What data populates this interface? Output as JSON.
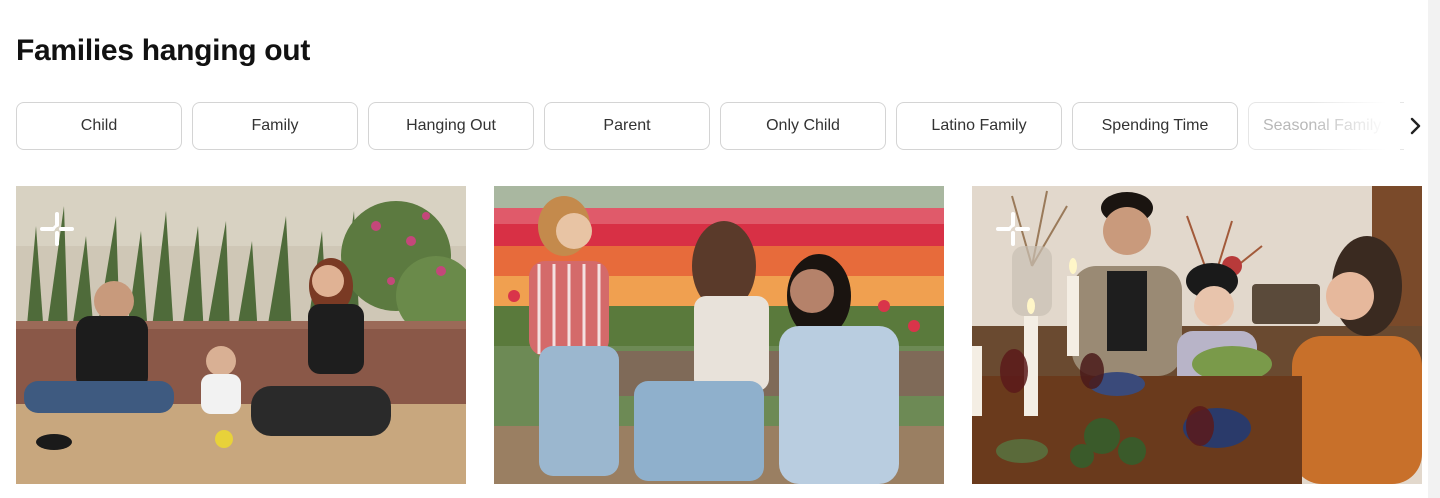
{
  "page": {
    "title": "Families hanging out"
  },
  "chips": [
    {
      "label": "Child"
    },
    {
      "label": "Family"
    },
    {
      "label": "Hanging Out"
    },
    {
      "label": "Parent"
    },
    {
      "label": "Only Child"
    },
    {
      "label": "Latino Family"
    },
    {
      "label": "Spending Time"
    },
    {
      "label": "Seasonal Family ..."
    }
  ],
  "icons": {
    "next": "chevron-right-icon",
    "badge": "premium-badge-icon"
  },
  "photos": [
    {
      "subject": "family-on-patio",
      "has_badge": true
    },
    {
      "subject": "friends-in-tulip-field",
      "has_badge": false
    },
    {
      "subject": "family-dinner-table",
      "has_badge": true
    }
  ],
  "colors": {
    "chip_border": "#d4d4d4",
    "chip_text": "#333333",
    "title_text": "#111111"
  }
}
